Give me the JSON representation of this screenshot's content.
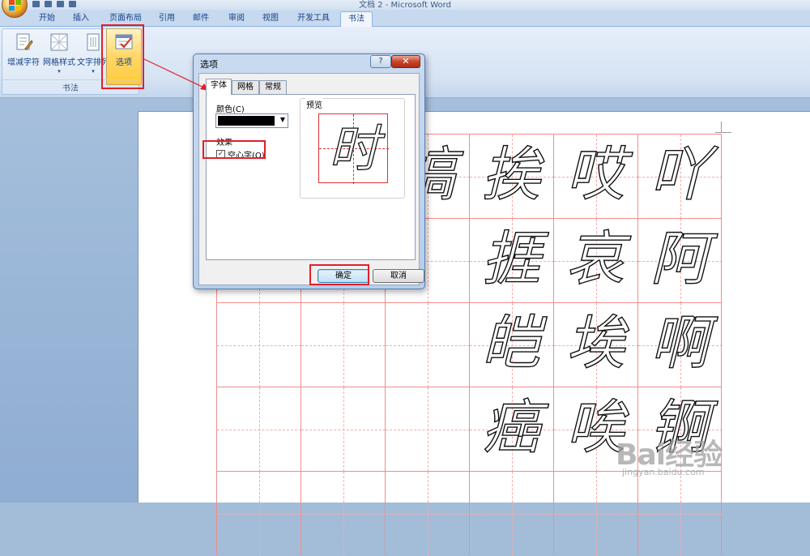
{
  "window": {
    "title": "文档 2 - Microsoft Word"
  },
  "tabs": [
    {
      "label": "开始"
    },
    {
      "label": "插入"
    },
    {
      "label": "页面布局"
    },
    {
      "label": "引用"
    },
    {
      "label": "邮件"
    },
    {
      "label": "审阅"
    },
    {
      "label": "视图"
    },
    {
      "label": "开发工具"
    },
    {
      "label": "书法",
      "active": true
    }
  ],
  "ribbon": {
    "group_label": "书法",
    "buttons": [
      {
        "label": "增减字符"
      },
      {
        "label": "网格样式",
        "dropdown": "▾"
      },
      {
        "label": "文字排列",
        "dropdown": "▾"
      },
      {
        "label": "选项"
      }
    ]
  },
  "dialog": {
    "title": "选项",
    "help": "?",
    "close": "✕",
    "tabs": [
      {
        "label": "字体",
        "active": true
      },
      {
        "label": "网格"
      },
      {
        "label": "常规"
      }
    ],
    "color_label": "颜色(C)",
    "color_value": "#000000",
    "effect_label": "效果",
    "hollow_checkbox": {
      "label": "空心字(O)",
      "checked": true,
      "mark": "✓"
    },
    "preview_label": "预览",
    "preview_char": "时",
    "ok_label": "确定",
    "cancel_label": "取消"
  },
  "document": {
    "chars": [
      {
        "ch": "搞",
        "row": 0,
        "col": 2,
        "partial": true
      },
      {
        "ch": "挨",
        "row": 0,
        "col": 3
      },
      {
        "ch": "哎",
        "row": 0,
        "col": 4
      },
      {
        "ch": "吖",
        "row": 0,
        "col": 5
      },
      {
        "ch": "捱",
        "row": 1,
        "col": 3
      },
      {
        "ch": "哀",
        "row": 1,
        "col": 4
      },
      {
        "ch": "阿",
        "row": 1,
        "col": 5
      },
      {
        "ch": "皑",
        "row": 2,
        "col": 3
      },
      {
        "ch": "埃",
        "row": 2,
        "col": 4
      },
      {
        "ch": "啊",
        "row": 2,
        "col": 5
      },
      {
        "ch": "癌",
        "row": 3,
        "col": 3
      },
      {
        "ch": "唉",
        "row": 3,
        "col": 4
      },
      {
        "ch": "锕",
        "row": 3,
        "col": 5
      }
    ]
  },
  "watermark": {
    "text": "Bai经验",
    "sub": "jingyan.baidu.com"
  },
  "colors": {
    "annotation": "#e0202a",
    "grid": "#f28c8c",
    "ribbon_accent": "#ffd766"
  }
}
